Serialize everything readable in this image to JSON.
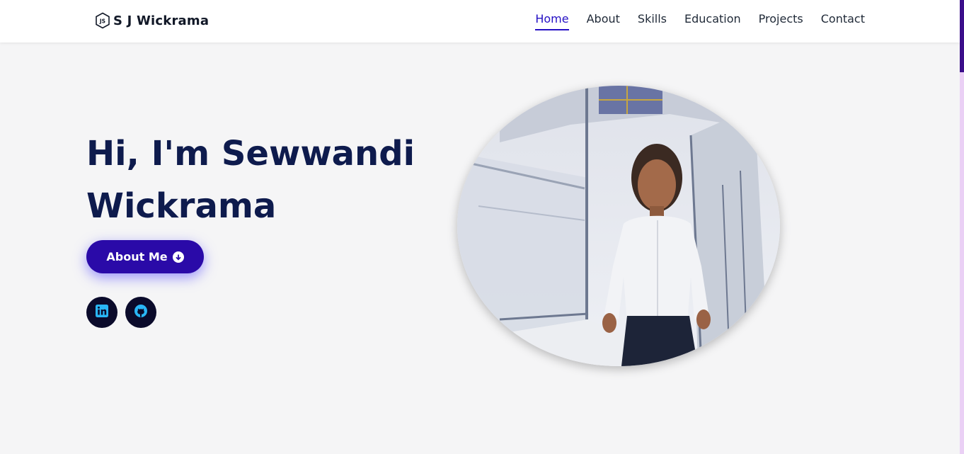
{
  "brand": {
    "logo_icon": "nodejs-icon",
    "name": "S J Wickrama"
  },
  "nav": {
    "items": [
      {
        "label": "Home",
        "active": true
      },
      {
        "label": "About",
        "active": false
      },
      {
        "label": "Skills",
        "active": false
      },
      {
        "label": "Education",
        "active": false
      },
      {
        "label": "Projects",
        "active": false
      },
      {
        "label": "Contact",
        "active": false
      }
    ]
  },
  "hero": {
    "title_line1": "Hi, I'm Sewwandi",
    "title_line2": "Wickrama",
    "button_label": "About Me",
    "button_icon": "arrow-down-circle-icon"
  },
  "social": [
    {
      "name": "linkedin-icon"
    },
    {
      "name": "github-icon"
    }
  ],
  "colors": {
    "accent": "#2510c4",
    "button": "#2a0aa8",
    "heading": "#0e1b4d",
    "social_bg": "#0b0b2b",
    "social_icon": "#29b6f6"
  }
}
